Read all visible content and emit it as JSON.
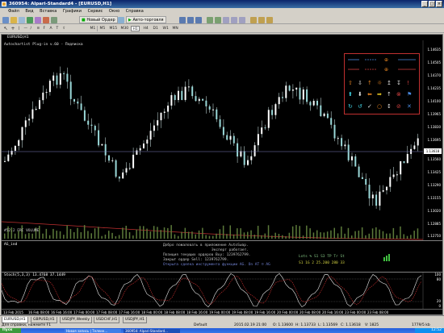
{
  "window": {
    "title": "360954: Alpari-Standard4 - [EURUSD,H1]"
  },
  "menu": [
    "Файл",
    "Вид",
    "Вставка",
    "Графики",
    "Сервис",
    "Окно",
    "Справка"
  ],
  "toolbar": {
    "new_order": "Новый Ордер",
    "autotrade": "Авто-торговля"
  },
  "timeframes": [
    "M1",
    "M5",
    "M15",
    "M30",
    "H1",
    "H4",
    "D1",
    "W1",
    "MN"
  ],
  "chart": {
    "symbol_label": "EURUSD,H1",
    "advisor_label": "Autochartist Plug-in v.60 - Подписка",
    "price_current": "1.13618",
    "price_labels": [
      "1.14635",
      "1.14505",
      "1.14370",
      "1.14235",
      "1.14100",
      "1.13965",
      "1.13830",
      "1.13695",
      "1.13560",
      "1.13425",
      "1.13290",
      "1.13155",
      "1.13020",
      "1.12885",
      "1.12750"
    ],
    "volume_label": "#52.2 FRC VOLUME",
    "time_labels": [
      "13 Feb 2015",
      "16 Feb 08:00",
      "16 Feb 16:00",
      "17 Feb 00:00",
      "17 Feb 08:00",
      "17 Feb 16:00",
      "18 Feb 00:00",
      "18 Feb 08:00",
      "18 Feb 16:00",
      "19 Feb 00:00",
      "19 Feb 08:00",
      "19 Feb 16:00",
      "20 Feb 00:00",
      "20 Feb 08:00",
      "20 Feb 16:00",
      "23 Feb 00:00",
      "23 Feb 08:00"
    ],
    "panel_title": "AG_ind",
    "messages": [
      "Добро пожаловать в приложение AutoSwap.",
      "Эксперт работает.",
      "Позиция текущих ордеров Buy: 1239762799.",
      "Закрыт ордер Sell: 1239762799.",
      "Открыта сделка инструмента функции AG.  On AT  ☺  AG"
    ],
    "stats_line1": "Lots  %  S1  S3  TP  Tr  St",
    "stats_line2": "S1  1G  2  25.200  280  33",
    "stoch_label": "Stoch(5,3,3) 13.4768 37.1449",
    "stoch_levels": [
      "100",
      "80",
      "20",
      "0"
    ]
  },
  "tabs": [
    "EURUSD,H1",
    "GBPUSD,H1",
    "USDJPY,Weekly",
    "USDCHF,H1",
    "USDJPY,H1"
  ],
  "status": {
    "hint": "Для справки, нажмите F1",
    "profile": "Default",
    "datetime": "2015.02.19 21:00",
    "open": "O: 1.13600",
    "high": "H: 1.13733",
    "low": "L: 1.13569",
    "close": "C: 1.13618",
    "volume": "V: 1825",
    "traffic": "1779/5 kb"
  },
  "taskbar": {
    "start": "Пуск",
    "items": [
      "Новая запись | Телеин...",
      "360954: Alpari-Standard..."
    ],
    "clock": "12:52"
  }
}
